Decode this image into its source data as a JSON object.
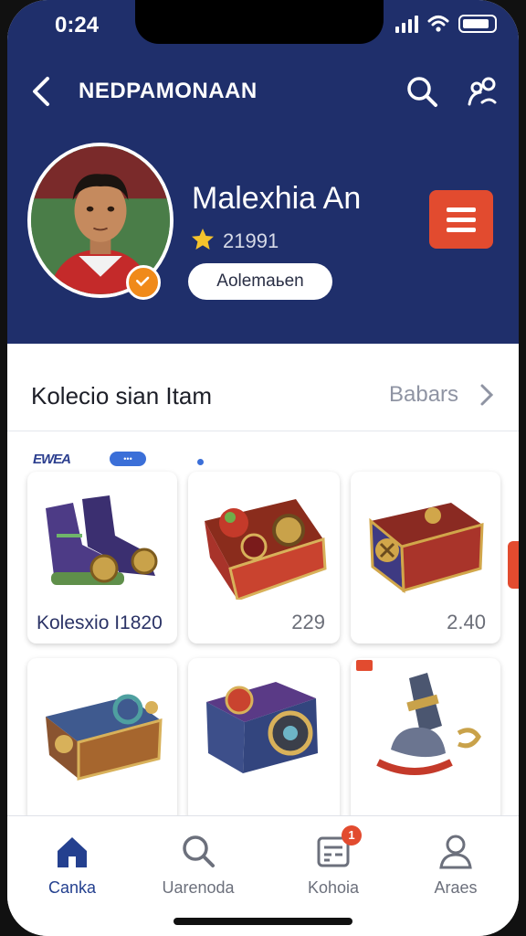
{
  "status": {
    "time": "0:24"
  },
  "nav": {
    "title": "NEDPAMONAAN"
  },
  "profile": {
    "name": "Malexhia An",
    "score": "21991",
    "button_label": "Aolemaьen"
  },
  "section": {
    "title": "Kolecio sian Itam",
    "link": "Babars"
  },
  "grid": {
    "brand_mark": "EWEA",
    "brand_pill": "•••"
  },
  "items": [
    {
      "label": "Kolesxio  I1820",
      "value": ""
    },
    {
      "label": "",
      "value": "229"
    },
    {
      "label": "",
      "value": "2.40"
    },
    {
      "label": "",
      "value": ""
    },
    {
      "label": "",
      "value": ""
    },
    {
      "label": "",
      "value": ""
    }
  ],
  "tabs": [
    {
      "label": "Canka",
      "icon": "home-icon"
    },
    {
      "label": "Uarenoda",
      "icon": "search-icon"
    },
    {
      "label": "Kohoia",
      "icon": "inbox-icon",
      "badge": "1"
    },
    {
      "label": "Araes",
      "icon": "profile-icon"
    }
  ],
  "colors": {
    "header": "#1f2f6b",
    "accent": "#e24b2f",
    "active_tab": "#24408f"
  }
}
